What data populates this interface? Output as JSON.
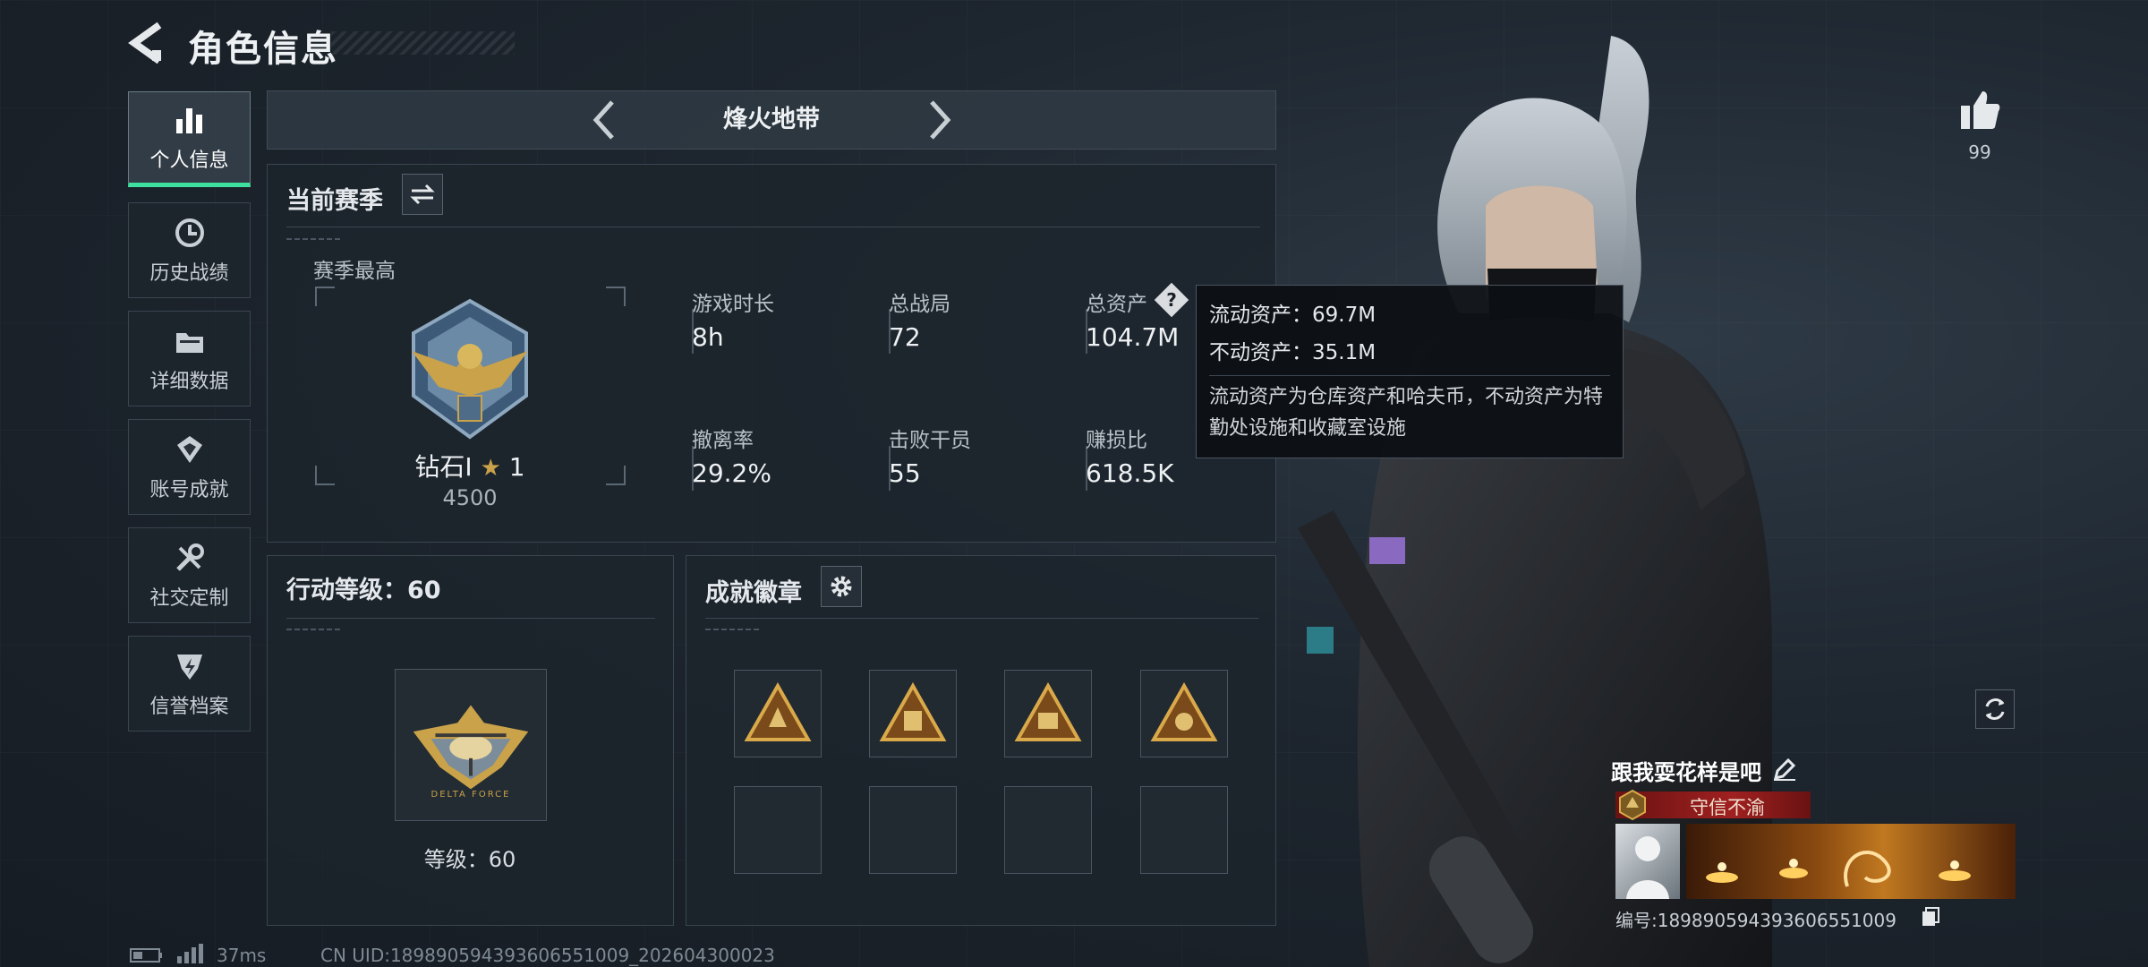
{
  "header": {
    "title": "角色信息"
  },
  "sidebar": {
    "items": [
      {
        "label": "个人信息",
        "icon": "bar-chart-icon",
        "active": true
      },
      {
        "label": "历史战绩",
        "icon": "history-clock-icon"
      },
      {
        "label": "详细数据",
        "icon": "folder-icon"
      },
      {
        "label": "账号成就",
        "icon": "achievement-icon"
      },
      {
        "label": "社交定制",
        "icon": "wrench-icon"
      },
      {
        "label": "信誉档案",
        "icon": "shield-bolt-icon"
      }
    ]
  },
  "mode_selector": {
    "current": "烽火地带"
  },
  "season": {
    "title": "当前赛季",
    "best_label": "赛季最高",
    "rank_name": "钻石I",
    "rank_stars": "1",
    "rank_score": "4500",
    "stats": [
      {
        "label": "游戏时长",
        "value": "8h"
      },
      {
        "label": "总战局",
        "value": "72"
      },
      {
        "label": "总资产",
        "value": "104.7M"
      },
      {
        "label": "撤离率",
        "value": "29.2%"
      },
      {
        "label": "击败干员",
        "value": "55"
      },
      {
        "label": "赚损比",
        "value": "618.5K"
      }
    ]
  },
  "tooltip": {
    "liquid": "流动资产：69.7M",
    "fixed": "不动资产：35.1M",
    "desc": "流动资产为仓库资产和哈夫币，不动资产为特勤处设施和收藏室设施"
  },
  "action_level": {
    "title": "行动等级：60",
    "level_text": "等级：60",
    "emblem_text": "DELTA FORCE"
  },
  "achievements": {
    "title": "成就徽章",
    "badges": [
      "achievement-badge-1",
      "achievement-badge-2",
      "achievement-badge-3",
      "achievement-badge-4"
    ],
    "empty_slots": 4
  },
  "profile": {
    "likes": "99",
    "nickname": "跟我耍花样是吧",
    "honor_title": "守信不渝",
    "id_text": "编号:18989059439360655​1009"
  },
  "footer": {
    "ping": "37ms",
    "uid": "CN UID:18989059439360655​1009_202604300023"
  },
  "colors": {
    "accent": "#3ee0a0",
    "gold": "#c9a24a",
    "honor_red": "#8a1a1a"
  }
}
